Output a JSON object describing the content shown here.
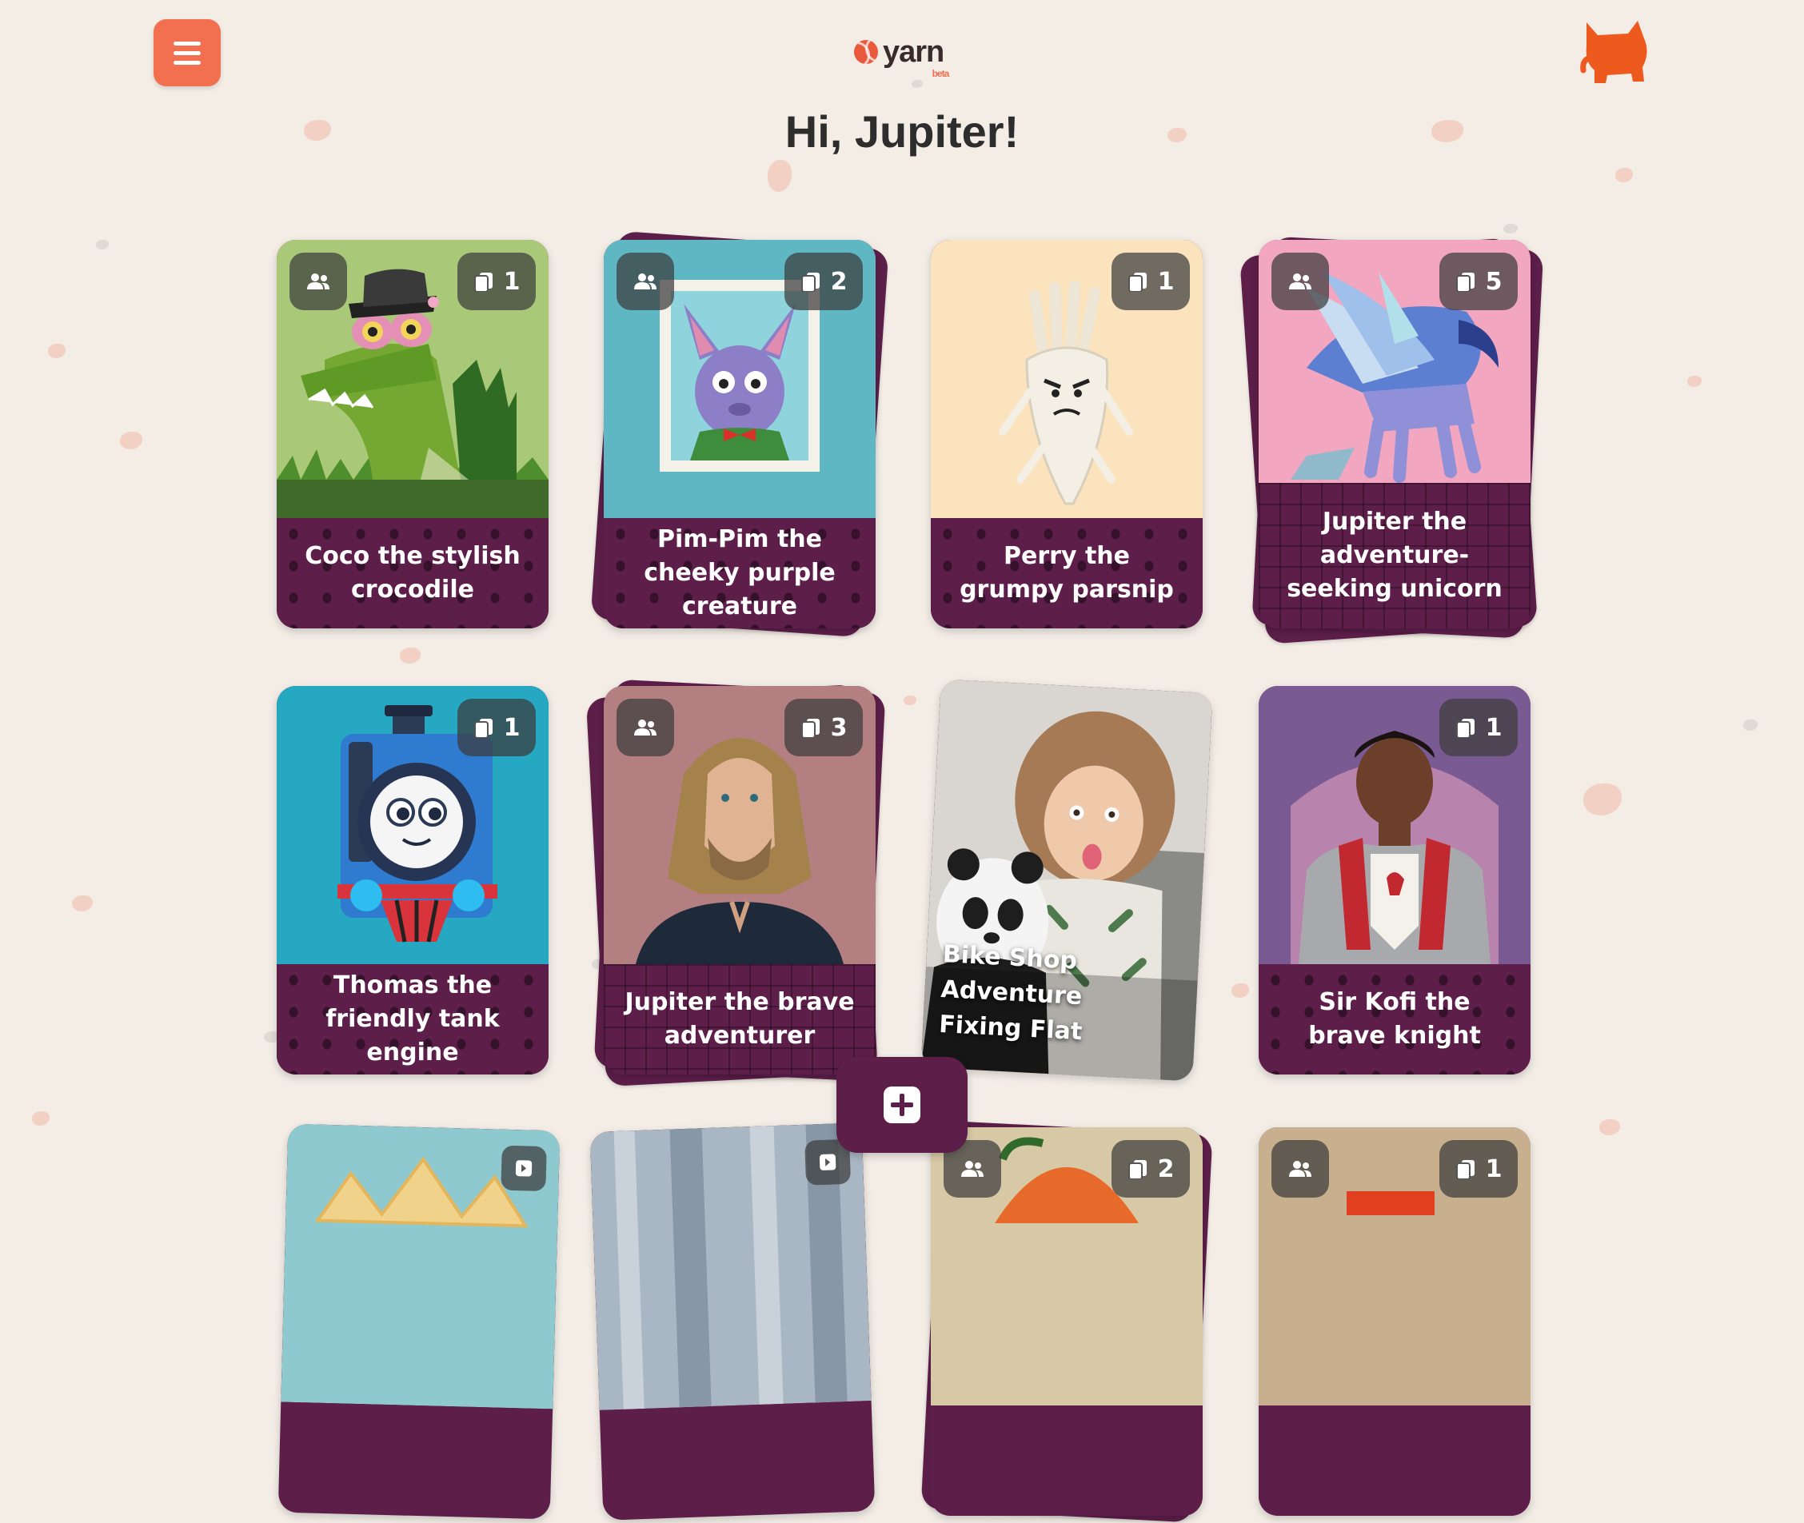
{
  "header": {
    "menu_icon": "hamburger-icon",
    "logo_text": "yarn",
    "logo_badge": "beta",
    "avatar_icon": "cat-avatar-icon",
    "greeting": "Hi, Jupiter!"
  },
  "cards": [
    {
      "title": "Coco the stylish crocodile",
      "shared": true,
      "count": "1",
      "stack": 0,
      "art": "crocodile"
    },
    {
      "title": "Pim-Pim the cheeky purple creature",
      "shared": true,
      "count": "2",
      "stack": 1,
      "art": "purple-creature"
    },
    {
      "title": "Perry the grumpy parsnip",
      "shared": false,
      "count": "1",
      "stack": 0,
      "art": "parsnip"
    },
    {
      "title": "Jupiter the adventure-seeking unicorn",
      "shared": true,
      "count": "5",
      "stack": 2,
      "art": "unicorn"
    },
    {
      "title": "Thomas the friendly tank engine",
      "shared": false,
      "count": "1",
      "stack": 0,
      "art": "tank-engine"
    },
    {
      "title": "Jupiter the brave adventurer",
      "shared": true,
      "count": "3",
      "stack": 2,
      "art": "adventurer"
    },
    {
      "title": "Bike Shop Adventure Fixing Flat",
      "shared": false,
      "count": "",
      "stack": 0,
      "art": "photo-child-panda"
    },
    {
      "title": "Sir Kofi the brave knight",
      "shared": false,
      "count": "1",
      "stack": 0,
      "art": "knight"
    }
  ],
  "partial_cards": [
    {
      "shared": false,
      "count": "",
      "art": "crown"
    },
    {
      "shared": false,
      "count": "",
      "art": "photo"
    },
    {
      "shared": true,
      "count": "2",
      "art": "fox"
    },
    {
      "shared": true,
      "count": "1",
      "art": "orange"
    }
  ],
  "add_button_icon": "plus-icon",
  "colors": {
    "background": "#f3ede6",
    "accent": "#f26f4f",
    "card": "#5d1e4a"
  }
}
